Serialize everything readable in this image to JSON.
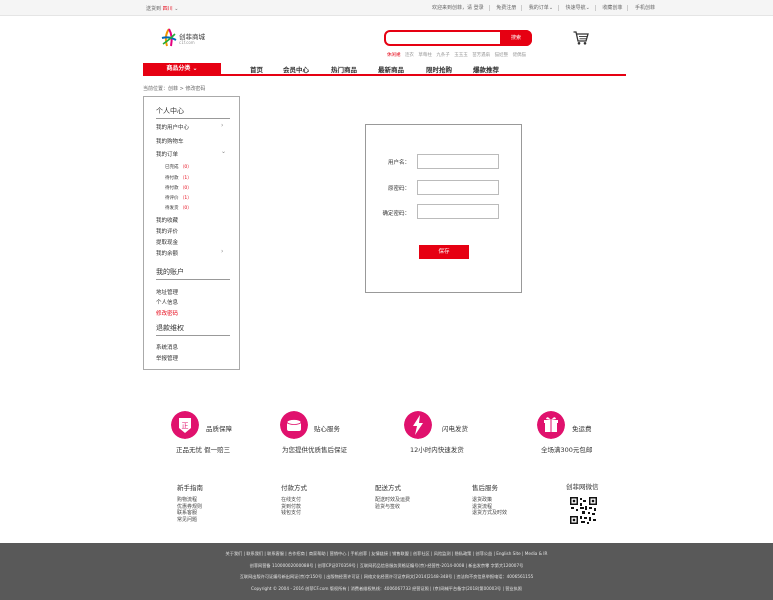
{
  "topbar": {
    "location_prefix": "送货到",
    "city": "四川",
    "links": [
      "欢迎来到创菲，请 登录",
      "免费注册",
      "我的订单",
      "快速导航",
      "收藏创菲",
      "手机创菲"
    ]
  },
  "logo": {
    "name": "创菲商城",
    "sub": "c1f.com"
  },
  "search": {
    "placeholder": "",
    "button": "搜索"
  },
  "hotwords": [
    "休闲裙",
    "连衣",
    "草莓柱",
    "九条子",
    "玉玉玉",
    "苗芳遇扇",
    "猫娃整",
    "佬偶猫"
  ],
  "nav": {
    "category": "商品分类",
    "items": [
      "首页",
      "会员中心",
      "热门商品",
      "最新商品",
      "限时抢购",
      "爆款推荐"
    ]
  },
  "breadcrumb": "当前位置：创菲 > 修改密码",
  "sidebar": {
    "sec1": "个人中心",
    "items1": [
      "我的用户中心",
      "我的购物车",
      "我的订单"
    ],
    "orders": [
      {
        "label": "已完成",
        "count": "（0）"
      },
      {
        "label": "待付款",
        "count": "（1）"
      },
      {
        "label": "待付款",
        "count": "（0）"
      },
      {
        "label": "待评价",
        "count": "（1）"
      },
      {
        "label": "待发货",
        "count": "（0）"
      }
    ],
    "items2": [
      "我的收藏",
      "我的评价",
      "提取现金",
      "我的余额"
    ],
    "sec2": "我的账户",
    "items3": [
      "地址管理",
      "个人信息",
      "修改密码"
    ],
    "sec3": "退款维权",
    "items4": [
      "系统消息",
      "举报管理"
    ]
  },
  "form": {
    "username_label": "用户名：",
    "old_pwd_label": "原密码：",
    "confirm_label": "确定密码：",
    "save": "保存"
  },
  "guarantees": [
    {
      "icon": "genuine-icon",
      "title": "品质保障",
      "desc": "正品无忧  假一赔三"
    },
    {
      "icon": "service-icon",
      "title": "贴心服务",
      "desc": "为您提供优质售后保证"
    },
    {
      "icon": "lightning-icon",
      "title": "闪电发货",
      "desc": "12小时内快速发货"
    },
    {
      "icon": "gift-icon",
      "title": "免运费",
      "desc": "全场满300元包邮"
    }
  ],
  "footer_cols": [
    {
      "title": "新手指南",
      "links": [
        "购物流程",
        "优惠券规则",
        "联系客服",
        "常见问题"
      ]
    },
    {
      "title": "付款方式",
      "links": [
        "在线支付",
        "货到付款",
        "钱包支付"
      ]
    },
    {
      "title": "配送方式",
      "links": [
        "配送时效及运费",
        "验货与签收"
      ]
    },
    {
      "title": "售后服务",
      "links": [
        "退货政策",
        "退货流程",
        "退货方式及时效"
      ]
    }
  ],
  "wechat_title": "创菲网微信",
  "footer": {
    "row1": "关于我们 | 联系我们 | 联系客服 | 合作招商 | 商家帮助 | 营销中心 | 手机创菲 | 友情链接 | 销售联盟 | 创菲社区 | 风险监测 | 隐私政策 | 创菲公益 | English Site | Media & IR",
    "row2": "创菲网营备 11000002000088号 | 创菲CP证070359号 | 互联网药品信息服务资格证编号(京)-经营性-2014-0008 | 新出发京零 字第大120007号",
    "row3": "互联网出版许可证编号新出网证(京)字150号 | 出版物经营许可证 | 网络文化经营许可证京网文[2014]2148-348号 | 违法和不良信息举报电话：4006561155",
    "row4": "Copyright © 2004 - 2016  创菲CF.com 版权所有 | 消费者维权热线：4006067733 经营证照 | (京)网械平台备字(2018)第00003号 | 营业执照"
  }
}
